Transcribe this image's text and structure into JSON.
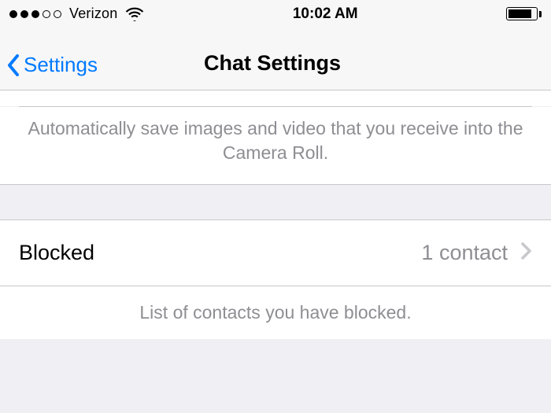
{
  "status_bar": {
    "carrier": "Verizon",
    "time": "10:02 AM",
    "signal_filled_dots": 3,
    "signal_total_dots": 5,
    "battery_pct": 85
  },
  "nav": {
    "back_label": "Settings",
    "title": "Chat Settings"
  },
  "sections": {
    "media_desc": "Automatically save images and video that you receive into the Camera Roll.",
    "blocked": {
      "label": "Blocked",
      "value": "1 contact",
      "desc": "List of contacts you have blocked."
    }
  },
  "colors": {
    "tint": "#007aff",
    "secondary": "#8e8e93"
  }
}
